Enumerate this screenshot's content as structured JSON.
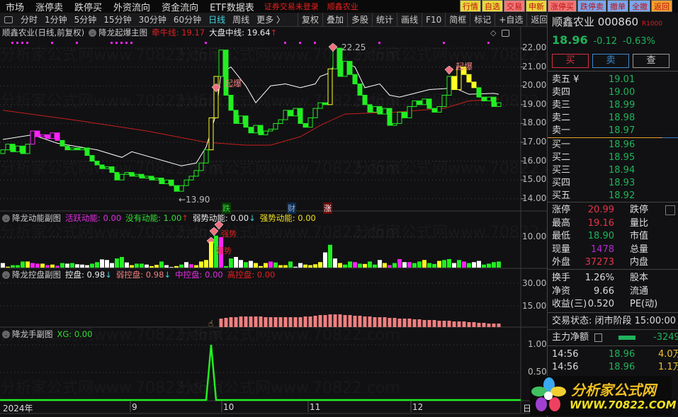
{
  "menubar": {
    "items": [
      "市场",
      "涨停卖",
      "跌停买",
      "外资流向",
      "资金流向",
      "ETF数据表"
    ],
    "login_warning": "证券交易未登录",
    "stock_name": "顺鑫农业",
    "quick": [
      {
        "label": "行情",
        "bg": "#e8d83a",
        "fg": "#c01010"
      },
      {
        "label": "自选",
        "bg": "#e8d83a",
        "fg": "#c01010"
      },
      {
        "label": "交易",
        "bg": "#f07878",
        "fg": "#c01010"
      },
      {
        "label": "申新",
        "bg": "#e8d83a",
        "fg": "#c01010"
      },
      {
        "label": "涨停买",
        "bg": "#f07878",
        "fg": "#c01010"
      },
      {
        "label": "跌停卖",
        "bg": "#78a8f0",
        "fg": "#c01010"
      },
      {
        "label": "撤单",
        "bg": "#78a8f0",
        "fg": "#c01010"
      },
      {
        "label": "全撤",
        "bg": "#78a8f0",
        "fg": "#c01010"
      },
      {
        "label": "返回",
        "bg": "#f0a030",
        "fg": "#c01010"
      }
    ]
  },
  "toolbar": {
    "periods": [
      "分时",
      "1分钟",
      "5分钟",
      "15分钟",
      "30分钟",
      "60分钟",
      "日线",
      "周线",
      "更多 〉"
    ],
    "active": "日线",
    "tools": [
      "复权",
      "叠加",
      "多股",
      "统计",
      "画线",
      "F10",
      "简框",
      "标记",
      "+自选",
      "返回"
    ]
  },
  "main": {
    "title": "顺鑫农业(日线,前复权)",
    "indicator": "降龙起爆主图",
    "line1": "牵牛线: 19.17",
    "line2": "大盘中线: 19.64",
    "arrow": "↑",
    "low_label": "←13.90",
    "high_label": "22.25",
    "signal_label": "起爆",
    "markers": {
      "die": "跌",
      "cai": "财",
      "zhang": "涨"
    },
    "price_ticks": [
      "22.00",
      "21.00",
      "20.00",
      "19.00",
      "18.00",
      "17.00",
      "16.00",
      "15.00",
      "14.00"
    ]
  },
  "volume": {
    "title": "降龙动能副图",
    "v1": "活跃动能: 0.00",
    "v2": "没有动能: 1.00",
    "v3": "弱势动能: 0.00",
    "v4": "强势动能: 0.00",
    "up": "↑",
    "down": "↓",
    "tick": "10.00",
    "signal": "强势"
  },
  "control": {
    "title": "降龙控盘副图",
    "v1": "控盘: 0.98",
    "v2": "弱控盘: 0.98",
    "v3": "中控盘: 0.00",
    "v4": "高控盘: 0.00",
    "down": "↓",
    "ticks": [
      "30.00",
      "15.00"
    ]
  },
  "hand": {
    "title": "降龙手副图",
    "v1": "XG: 0.00",
    "ticks": [
      "1.00",
      "0.50"
    ]
  },
  "time_axis": [
    "2024年",
    "9",
    "10",
    "11",
    "12",
    "日"
  ],
  "quote": {
    "name": "顺鑫农业",
    "code": "000860",
    "tag": "R1000",
    "price": "18.96",
    "change": "-0.12",
    "pct": "-0.63%",
    "buy": "买",
    "sell": "卖",
    "query": "查",
    "asks": [
      {
        "l": "卖五 ¥",
        "v": "19.01"
      },
      {
        "l": "卖四",
        "v": "19.00"
      },
      {
        "l": "卖三",
        "v": "18.99"
      },
      {
        "l": "卖二",
        "v": "18.98"
      },
      {
        "l": "卖一",
        "v": "18.97"
      }
    ],
    "bids": [
      {
        "l": "买一",
        "v": "18.96"
      },
      {
        "l": "买二",
        "v": "18.95"
      },
      {
        "l": "买三",
        "v": "18.94"
      },
      {
        "l": "买四",
        "v": "18.93"
      },
      {
        "l": "买五",
        "v": "18.92"
      }
    ],
    "stats": [
      {
        "l": "涨停",
        "v": "20.99",
        "c": "r",
        "l2": "跌停"
      },
      {
        "l": "最高",
        "v": "19.16",
        "c": "r",
        "l2": "量比"
      },
      {
        "l": "最低",
        "v": "18.90",
        "c": "g",
        "l2": "市值"
      },
      {
        "l": "现量",
        "v": "1478",
        "c": "p",
        "l2": "总量"
      },
      {
        "l": "外盘",
        "v": "37273",
        "c": "r",
        "l2": "内盘"
      }
    ],
    "stats2": [
      {
        "l": "换手",
        "v": "1.26%",
        "l2": "股本"
      },
      {
        "l": "净资",
        "v": "9.66",
        "l2": "流通"
      },
      {
        "l": "收益(三)",
        "v": "0.520",
        "l2": "PE(动)"
      }
    ],
    "status": "交易状态: 闭市阶段 15:00:00",
    "main_flow": "主力净额",
    "main_flow_val": "-3249",
    "ticks": [
      {
        "t": "14:56",
        "p": "18.96",
        "v": "4.0万"
      },
      {
        "t": "14:56",
        "p": "18.96",
        "v": "1.1万"
      }
    ]
  },
  "logo": {
    "name": "分析家公式网",
    "url": "WWW.70822.COM"
  },
  "watermark": "分析家公式网www.70822.com",
  "colors": {
    "up": "#22ee22",
    "yellow": "#ffff22",
    "magenta": "#ff22ff",
    "white": "#ffffff",
    "salmon": "#f08080",
    "ma_red": "#c81e1e"
  },
  "chart_data": {
    "type": "candlestick",
    "closes": [
      16.6,
      16.9,
      16.5,
      16.8,
      16.4,
      16.9,
      17.6,
      17.3,
      17.4,
      17.2,
      17.5,
      17.1,
      16.8,
      16.6,
      16.7,
      16.6,
      16.7,
      16.3,
      16.0,
      15.8,
      15.6,
      15.7,
      15.4,
      15.0,
      15.3,
      15.4,
      15.2,
      15.3,
      15.1,
      15.2,
      15.0,
      15.1,
      14.8,
      15.0,
      14.7,
      14.4,
      14.7,
      15.0,
      15.2,
      15.5,
      15.9,
      16.6,
      18.3,
      20.5,
      21.9,
      19.5,
      18.7,
      18.0,
      18.4,
      17.8,
      17.5,
      17.9,
      17.4,
      17.6,
      17.7,
      18.0,
      18.2,
      18.7,
      18.4,
      18.8,
      18.0,
      17.8,
      18.3,
      18.8,
      19.1,
      19.0,
      20.9,
      22.0,
      20.5,
      21.3,
      20.6,
      20.1,
      19.5,
      19.0,
      18.6,
      18.9,
      18.5,
      18.8,
      17.9,
      18.0,
      18.6,
      18.3,
      18.9,
      19.2,
      19.0,
      19.3,
      18.8,
      18.6,
      18.9,
      19.5,
      20.5,
      19.8,
      21.0,
      20.6,
      20.2,
      19.9,
      19.4,
      19.2,
      19.4,
      18.9,
      19.1
    ],
    "candle_colors": "ggggggmmmmmmggggggggggggggggggggggggggggggyyggggggggggggggggggggggyggggggggggggggggggggggggyyyyygggg",
    "ma_red": [
      [
        0,
        18.7
      ],
      [
        14,
        18.2
      ],
      [
        29,
        17.6
      ],
      [
        41,
        17.0
      ],
      [
        49,
        16.85
      ],
      [
        54,
        16.85
      ],
      [
        60,
        17.3
      ],
      [
        64,
        17.9
      ],
      [
        69,
        18.5
      ],
      [
        79,
        18.6
      ],
      [
        89,
        18.8
      ],
      [
        94,
        19.2
      ],
      [
        100,
        19.3
      ]
    ],
    "ma_white": [
      [
        0,
        17.15
      ],
      [
        6,
        17.4
      ],
      [
        11,
        16.95
      ],
      [
        19,
        16.6
      ],
      [
        24,
        16.2
      ],
      [
        26,
        16.5
      ],
      [
        36,
        15.75
      ],
      [
        39,
        15.9
      ],
      [
        41,
        16.75
      ],
      [
        43,
        18.5
      ],
      [
        44,
        20.7
      ],
      [
        46,
        21.0
      ],
      [
        49,
        20.0
      ],
      [
        51,
        19.1
      ],
      [
        54,
        20.0
      ],
      [
        57,
        20.1
      ],
      [
        60,
        19.9
      ],
      [
        63,
        20.1
      ],
      [
        64,
        20.5
      ],
      [
        66,
        20.7
      ],
      [
        67,
        21.25
      ],
      [
        69,
        21.25
      ],
      [
        71,
        21.0
      ],
      [
        73,
        19.9
      ],
      [
        76,
        20.1
      ],
      [
        78,
        19.5
      ],
      [
        80,
        19.4
      ],
      [
        83,
        19.6
      ],
      [
        86,
        19.8
      ],
      [
        89,
        19.85
      ],
      [
        91,
        19.9
      ],
      [
        94,
        19.55
      ],
      [
        99,
        19.6
      ],
      [
        100,
        19.55
      ]
    ],
    "price_range": [
      14.0,
      22.0
    ],
    "volume": {
      "values": [
        1.5,
        0.3,
        0.8,
        0.8,
        2,
        2,
        1.5,
        1.3,
        1.3,
        0.8,
        1,
        0.6,
        1.5,
        1.3,
        1.5,
        1.1,
        1.0,
        0.8,
        1.3,
        1.8,
        2.7,
        2.5,
        1.5,
        3.0,
        3.5,
        1.7,
        0.8,
        1.3,
        1.3,
        1.0,
        0.5,
        0.9,
        2.0,
        0.8,
        0.2,
        0.5,
        1.0,
        1.8,
        1.1,
        0.8,
        2.0,
        2.5,
        8.5,
        10.5,
        10.0,
        0.5,
        3.0,
        3.5,
        2.5,
        1.8,
        2.2,
        1.5,
        0.5,
        1.5,
        2.0,
        1.7,
        0.8,
        0.8,
        2.0,
        0.3,
        1.5,
        1.0,
        0.8,
        1.1,
        1.8,
        5.0,
        7.5,
        3,
        1.5,
        1.0,
        2.0,
        1.8,
        1.3,
        1.2,
        2.0,
        1.0,
        2.5,
        1.5,
        0.8,
        1.5,
        2.8,
        1.8,
        1.8,
        1.5,
        2.0,
        2.5,
        1.5,
        1.2,
        2.2,
        2.5,
        2.8,
        1.5,
        2.5,
        2.0,
        1.5,
        1.8,
        2.2,
        1.0,
        1.3,
        1.8,
        2.0
      ],
      "colors": "wygggymmymymgwgwwwggswwggwyggwyygwwygw myyyygmggwwgwyyymgyygwwyyyywgwyggmgygg wymgmwmggyggyggwgmgwwgg"
    },
    "control": {
      "start_index": 44,
      "values": [
        6,
        6.5,
        7,
        7,
        7.5,
        7.5,
        7.5,
        7.5,
        7.5,
        7,
        7,
        7,
        7,
        7,
        7,
        7,
        7,
        7.5,
        7.5,
        8,
        8.5,
        8.5,
        9,
        9,
        9,
        8.5,
        8.5,
        8,
        8,
        7.5,
        7.5,
        7,
        7,
        7,
        6.5,
        6.5,
        6,
        6,
        6,
        5.5,
        5.5,
        5,
        5,
        5,
        4.5,
        4.5,
        4.5,
        4,
        4,
        4,
        3.5,
        3.5,
        3,
        3,
        2.5,
        2.5,
        2.5
      ]
    },
    "xg": {
      "spike_index": 42,
      "value": 1.0
    },
    "signal_dots": [
      2,
      3,
      4,
      5,
      10,
      15,
      22,
      23,
      24,
      25,
      26,
      41,
      57,
      60,
      63,
      76,
      89,
      98
    ]
  }
}
